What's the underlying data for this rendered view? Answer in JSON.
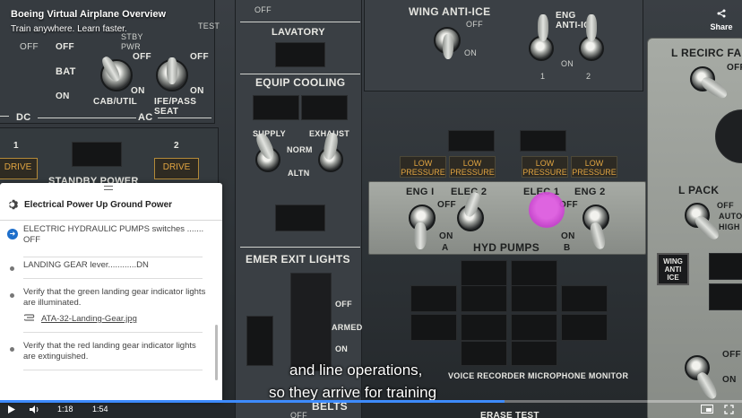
{
  "header": {
    "title": "Boeing Virtual Airplane Overview",
    "subtitle": "Train anywhere. Learn faster.",
    "share_label": "Share",
    "share_icon": "share-icon"
  },
  "cockpit": {
    "off_top": "OFF",
    "test1": "TEST",
    "stby_pwr": "STBY\nPWR",
    "bat_off": "OFF",
    "bat": "BAT",
    "bat_on": "ON",
    "dc": "DC",
    "ac": "AC",
    "cab_util": "CAB/UTIL",
    "cab_off": "OFF",
    "cab_on": "ON",
    "ife_pass_seat": "IFE/PASS\nSEAT",
    "ife_off": "OFF",
    "ife_on": "ON",
    "drive_1_num": "1",
    "drive_2_num": "2",
    "drive_label": "DRIVE",
    "standby_power": "STANDBY POWER",
    "lavatory": "LAVATORY",
    "equip_cooling": "EQUIP COOLING",
    "supply": "SUPPLY",
    "exhaust": "EXHAUST",
    "norm": "NORM",
    "altn": "ALTN",
    "emer_exit_lights": "EMER EXIT LIGHTS",
    "emer_off": "OFF",
    "emer_armed": "ARMED",
    "emer_on": "ON",
    "belts": "BELTS",
    "off_bottom": "OFF",
    "wing_anti_ice": "WING ANTI-ICE",
    "wing_off": "OFF",
    "wing_on": "ON",
    "eng_anti_ice": "ENG\nANTI-ICE",
    "eng_ai_on": "ON",
    "eng_ai_1": "1",
    "eng_ai_2": "2",
    "low_pressure": "LOW\nPRESSURE",
    "eng1": "ENG I",
    "elec2": "ELEC 2",
    "elec1": "ELEC 1",
    "eng2": "ENG 2",
    "hyd_off_a": "OFF",
    "hyd_off_b": "OFF",
    "hyd_on_a": "ON",
    "hyd_on_b": "ON",
    "hyd_a": "A",
    "hyd_b": "B",
    "hyd_pumps": "HYD PUMPS",
    "voice_recorder": "VOICE RECORDER MICROPHONE MONITOR",
    "erase_test": "ERASE  TEST",
    "l_recirc_fan": "L RECIRC FAN",
    "l_recirc_off": "OFF",
    "l_pack": "L PACK",
    "pack_off": "OFF",
    "pack_auto": "AUTO",
    "pack_high": "HIGH",
    "wing_anti_ice_btn": "WING\nANTI\nICE",
    "lower_off": "OFF",
    "lower_on": "ON"
  },
  "procedure": {
    "title": "Electrical Power Up Ground Power",
    "title_icon": "gear-icon",
    "steps": [
      {
        "text": "ELECTRIC HYDRAULIC PUMPS switches ....... OFF",
        "active": true
      },
      {
        "text": "LANDING GEAR lever............DN",
        "active": false
      },
      {
        "text": "Verify that the green landing gear indicator lights are illuminated.",
        "active": false,
        "attachment": "ATA-32-Landing-Gear.jpg"
      },
      {
        "text": "Verify that the red landing gear indicator lights are extinguished.",
        "active": false
      }
    ]
  },
  "captions": {
    "line1": "and line operations,",
    "line2": "so they arrive for training"
  },
  "player": {
    "current_time": "1:18",
    "duration": "1:54",
    "progress": 0.68,
    "accent": "#3d8bff"
  }
}
